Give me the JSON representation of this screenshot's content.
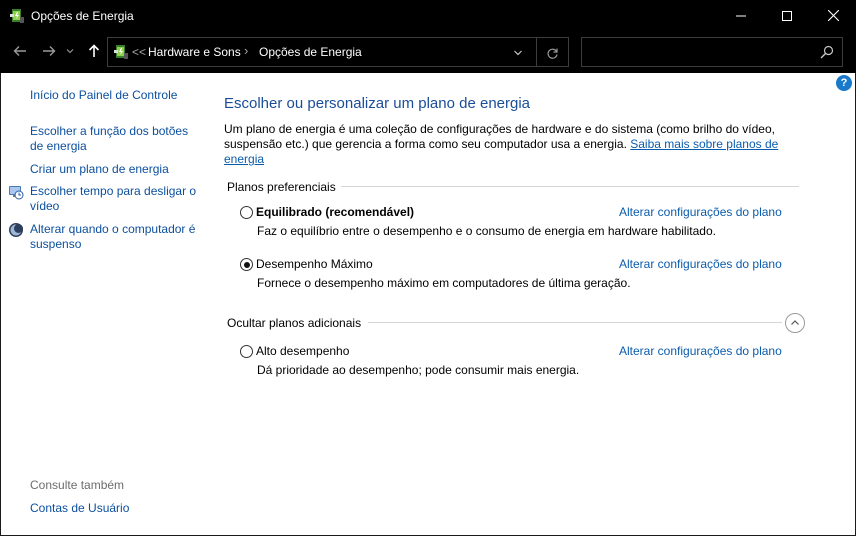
{
  "window": {
    "title": "Opções de Energia"
  },
  "address": {
    "overflow": "<<",
    "crumbs": [
      "Hardware e Sons",
      "Opções de Energia"
    ],
    "separator": "›"
  },
  "search": {
    "placeholder": ""
  },
  "help": {
    "label": "?"
  },
  "sidebar": {
    "home": "Início do Painel de Controle",
    "items": [
      "Escolher a função dos botões de energia",
      "Criar um plano de energia",
      "Escolher tempo para desligar o vídeo",
      "Alterar quando o computador é suspenso"
    ],
    "see_also_label": "Consulte também",
    "see_also_items": [
      "Contas de Usuário"
    ]
  },
  "main": {
    "title": "Escolher ou personalizar um plano de energia",
    "intro_text": "Um plano de energia é uma coleção de configurações de hardware e do sistema (como brilho do vídeo, suspensão etc.) que gerencia a forma como seu computador usa a energia. ",
    "intro_link": "Saiba mais sobre planos de energia",
    "preferred_label": "Planos preferenciais",
    "hidden_label": "Ocultar planos adicionais",
    "change_link": "Alterar configurações do plano",
    "plans": [
      {
        "name": "Equilibrado (recomendável)",
        "description": "Faz o equilíbrio entre o desempenho e o consumo de energia em hardware habilitado.",
        "selected": false
      },
      {
        "name": "Desempenho Máximo",
        "description": "Fornece o desempenho máximo em computadores de última geração.",
        "selected": true
      },
      {
        "name": "Alto desempenho",
        "description": "Dá prioridade ao desempenho; pode consumir mais energia.",
        "selected": false
      }
    ]
  },
  "colors": {
    "link": "#0b5cad",
    "title": "#1a4d99",
    "chrome": "#000000"
  }
}
